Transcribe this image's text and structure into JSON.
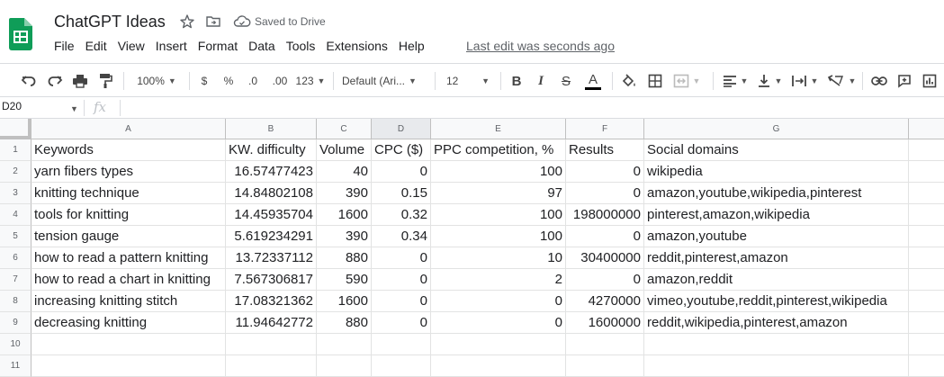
{
  "app": {
    "title": "ChatGPT Ideas",
    "saved_status": "Saved to Drive",
    "last_edit": "Last edit was seconds ago",
    "brand_color": "#0f9d58"
  },
  "menu": [
    "File",
    "Edit",
    "View",
    "Insert",
    "Format",
    "Data",
    "Tools",
    "Extensions",
    "Help"
  ],
  "toolbar": {
    "zoom": "100%",
    "currency": "$",
    "percent": "%",
    "decimal_decrease": ".0",
    "decimal_increase": ".00",
    "more_formats": "123",
    "font": "Default (Ari...",
    "font_size": "12",
    "bold": "B",
    "italic": "I",
    "strikethrough": "S",
    "text_color": "A",
    "text_color_value": "#000000"
  },
  "formula_bar": {
    "cell_ref": "D20",
    "fx": "fx",
    "value": ""
  },
  "columns": [
    "A",
    "B",
    "C",
    "D",
    "E",
    "F",
    "G"
  ],
  "selected_column": "D",
  "rows": [
    {
      "n": "1",
      "cells": [
        "Keywords",
        "KW. difficulty",
        "Volume",
        "CPC ($)",
        "PPC competition, %",
        "Results",
        "Social domains"
      ]
    },
    {
      "n": "2",
      "cells": [
        "yarn fibers types",
        "16.57477423",
        "40",
        "0",
        "100",
        "0",
        "wikipedia"
      ]
    },
    {
      "n": "3",
      "cells": [
        "knitting technique",
        "14.84802108",
        "390",
        "0.15",
        "97",
        "0",
        "amazon,youtube,wikipedia,pinterest"
      ]
    },
    {
      "n": "4",
      "cells": [
        "tools for knitting",
        "14.45935704",
        "1600",
        "0.32",
        "100",
        "198000000",
        "pinterest,amazon,wikipedia"
      ]
    },
    {
      "n": "5",
      "cells": [
        "tension gauge",
        "5.619234291",
        "390",
        "0.34",
        "100",
        "0",
        "amazon,youtube"
      ]
    },
    {
      "n": "6",
      "cells": [
        "how to read a pattern knitting",
        "13.72337112",
        "880",
        "0",
        "10",
        "30400000",
        "reddit,pinterest,amazon"
      ]
    },
    {
      "n": "7",
      "cells": [
        "how to read a chart in knitting",
        "7.567306817",
        "590",
        "0",
        "2",
        "0",
        "amazon,reddit"
      ]
    },
    {
      "n": "8",
      "cells": [
        "increasing knitting stitch",
        "17.08321362",
        "1600",
        "0",
        "0",
        "4270000",
        "vimeo,youtube,reddit,pinterest,wikipedia"
      ]
    },
    {
      "n": "9",
      "cells": [
        "decreasing knitting",
        "11.94642772",
        "880",
        "0",
        "0",
        "1600000",
        "reddit,wikipedia,pinterest,amazon"
      ]
    },
    {
      "n": "10",
      "cells": [
        "",
        "",
        "",
        "",
        "",
        "",
        ""
      ]
    },
    {
      "n": "11",
      "cells": [
        "",
        "",
        "",
        "",
        "",
        "",
        ""
      ]
    }
  ]
}
